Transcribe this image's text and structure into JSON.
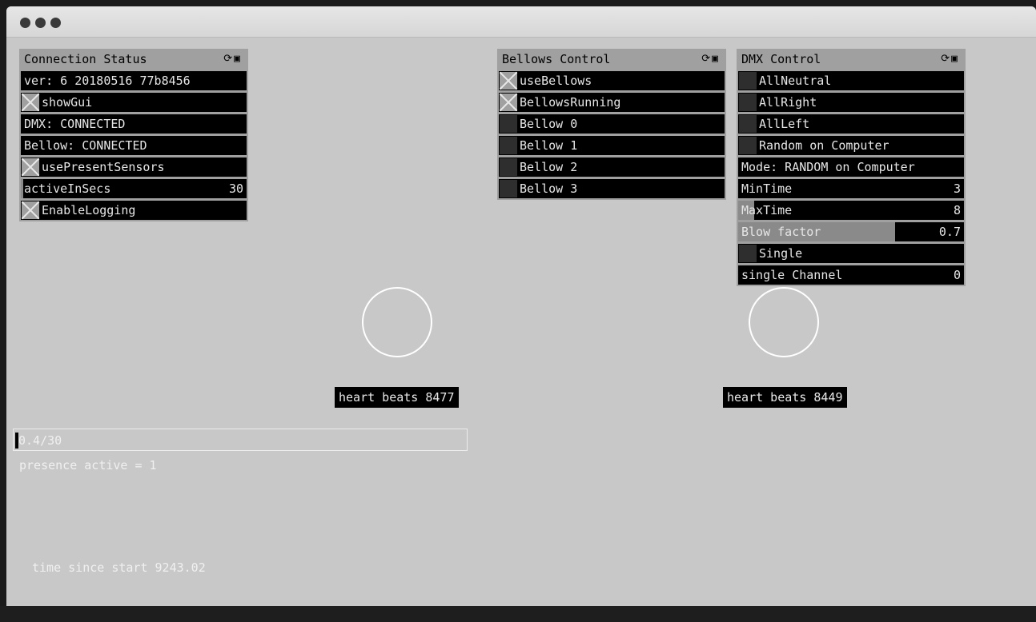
{
  "connection_panel": {
    "title": "Connection Status",
    "header_icons": "⟳▣",
    "version": "ver: 6 20180516 77b8456",
    "show_gui": {
      "label": "showGui",
      "checked": true
    },
    "dmx_status": "DMX: CONNECTED",
    "bellow_status": "Bellow: CONNECTED",
    "use_present_sensors": {
      "label": "usePresentSensors",
      "checked": true
    },
    "active_in_secs": {
      "label": "activeInSecs",
      "value": "30"
    },
    "enable_logging": {
      "label": "EnableLogging",
      "checked": true
    }
  },
  "bellows_panel": {
    "title": "Bellows Control",
    "header_icons": "⟳▣",
    "use_bellows": {
      "label": "useBellows",
      "checked": true
    },
    "bellows_running": {
      "label": "BellowsRunning",
      "checked": true
    },
    "bellow_0": {
      "label": "Bellow 0",
      "checked": false
    },
    "bellow_1": {
      "label": "Bellow 1",
      "checked": false
    },
    "bellow_2": {
      "label": "Bellow 2",
      "checked": false
    },
    "bellow_3": {
      "label": "Bellow 3",
      "checked": false
    }
  },
  "dmx_panel": {
    "title": "DMX Control",
    "header_icons": "⟳▣",
    "all_neutral": {
      "label": "AllNeutral",
      "checked": false
    },
    "all_right": {
      "label": "AllRight",
      "checked": false
    },
    "all_left": {
      "label": "AllLeft",
      "checked": false
    },
    "random_on_computer": {
      "label": "Random on Computer",
      "checked": false
    },
    "mode": "Mode: RANDOM on Computer",
    "min_time": {
      "label": "MinTime",
      "value": "3"
    },
    "max_time": {
      "label": "MaxTime",
      "value": "8"
    },
    "blow_factor": {
      "label": "Blow factor",
      "value": "0.7"
    },
    "single": {
      "label": "Single",
      "checked": false
    },
    "single_channel": {
      "label": "single Channel",
      "value": "0"
    }
  },
  "heartbeats": {
    "left": "heart beats 8477",
    "right": "heart beats 8449"
  },
  "progress": {
    "text": "0.4/30",
    "fraction": 0.013
  },
  "presence": "presence active = 1",
  "time_since_start": "time since start 9243.02"
}
